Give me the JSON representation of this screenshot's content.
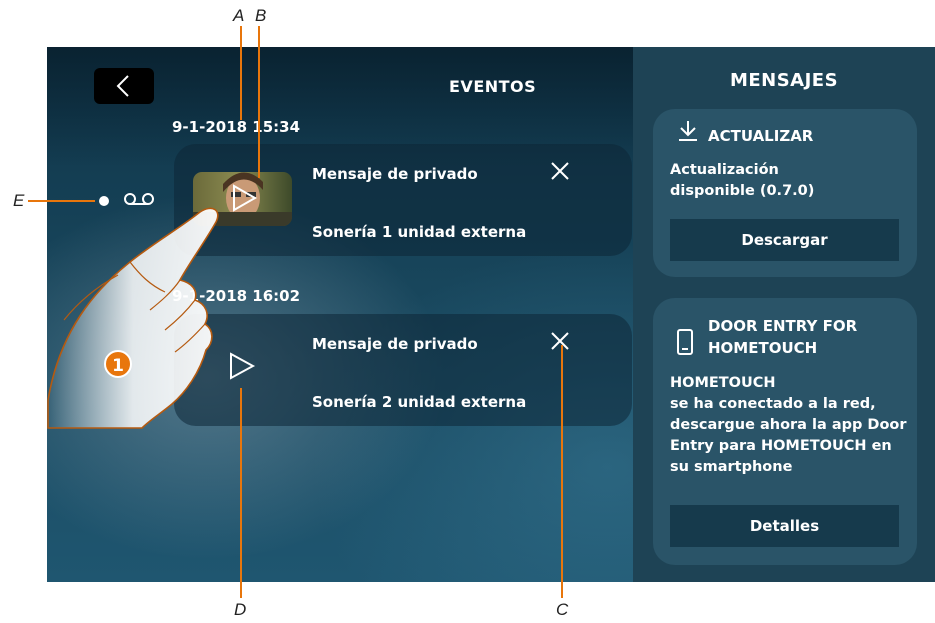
{
  "events_panel": {
    "title": "EVENTOS",
    "events": [
      {
        "date": "9-1-2018  15:34",
        "line1": "Mensaje de privado",
        "line2": "Sonería 1 unidad externa"
      },
      {
        "date": "9-1-2018  16:02",
        "line1": "Mensaje de privado",
        "line2": "Sonería 2 unidad externa"
      }
    ]
  },
  "messages_panel": {
    "title": "MENSAJES",
    "update": {
      "heading": "ACTUALIZAR",
      "body_line1": "Actualización",
      "body_line2": "disponible (0.7.0)",
      "button": "Descargar"
    },
    "door_entry": {
      "heading_line1": "DOOR ENTRY FOR",
      "heading_line2": "HOMETOUCH",
      "body_lines": [
        "HOMETOUCH",
        "se ha conectado a la red,",
        "descargue ahora la app Door",
        "Entry para HOMETOUCH en",
        "su smartphone"
      ],
      "button": "Detalles"
    }
  },
  "step_badge": "1",
  "callouts": {
    "a": "A",
    "b": "B",
    "c": "C",
    "d": "D",
    "e": "E"
  },
  "icons": [
    "back-icon",
    "close-icon",
    "play-icon",
    "voicemail-icon",
    "download-icon",
    "smartphone-icon"
  ],
  "colors": {
    "screen": "#18465c",
    "sidebar": "#1e4355",
    "card": "#2a5468",
    "badge": "#e8760c"
  }
}
